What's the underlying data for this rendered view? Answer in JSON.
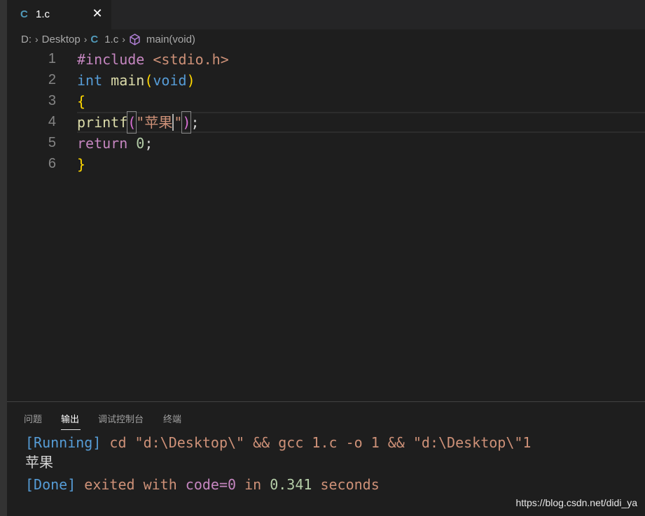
{
  "tab": {
    "icon_text": "C",
    "label": "1.c",
    "close_glyph": "✕"
  },
  "breadcrumb": {
    "drive": "D:",
    "folder": "Desktop",
    "file_icon_text": "C",
    "file": "1.c",
    "symbol": "main(void)",
    "separator": "›"
  },
  "editor": {
    "line_numbers": [
      "1",
      "2",
      "3",
      "4",
      "5",
      "6"
    ],
    "lines": {
      "l1": {
        "directive": "#include",
        "space": " ",
        "header": "<stdio.h>"
      },
      "l2": {
        "type": "int",
        "space": " ",
        "fn": "main",
        "open": "(",
        "param": "void",
        "close": ")"
      },
      "l3": {
        "brace": "{"
      },
      "l4": {
        "fn": "printf",
        "open": "(",
        "str_open": "\"苹果",
        "str_close": "\"",
        "close": ")",
        "semi": ";"
      },
      "l5": {
        "kw": "return",
        "space": " ",
        "num": "0",
        "semi": ";"
      },
      "l6": {
        "brace": "}"
      }
    }
  },
  "panel": {
    "tabs": [
      "问题",
      "输出",
      "调试控制台",
      "终端"
    ],
    "active_tab": "输出",
    "output": {
      "running_tag": "[Running]",
      "running_cmd": " cd \"d:\\Desktop\\\" && gcc 1.c -o 1 && \"d:\\Desktop\\\"1",
      "program_output": "苹果",
      "done_tag": "[Done]",
      "exited_with": " exited with ",
      "code_label": "code=0",
      "in_label": " in ",
      "elapsed": "0.341",
      "seconds_label": " seconds"
    }
  },
  "watermark": "https://blog.csdn.net/didi_ya"
}
